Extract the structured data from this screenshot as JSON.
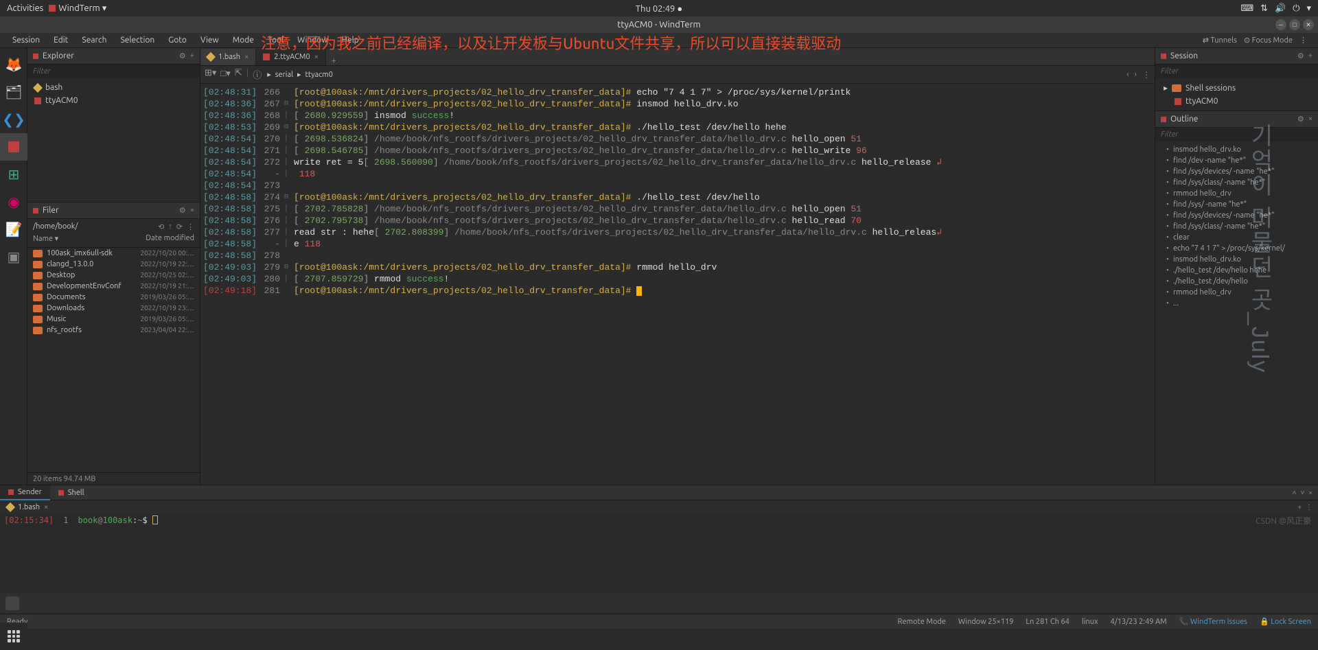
{
  "topbar": {
    "activities": "Activities",
    "app": "WindTerm ▾",
    "clock": "Thu 02:49 ●",
    "tray": [
      "⌨",
      "⇅",
      "🔊",
      "⏻",
      "▾"
    ]
  },
  "titlebar": {
    "title": "ttyACM0 - WindTerm"
  },
  "annotation": "注意，因为我之前已经编译，以及让开发板与Ubuntu文件共享，所以可以直接装载驱动",
  "watermark": "기억이 머물던 곳_July",
  "credit": "CSDN @风正豪",
  "menu": [
    "Session",
    "Edit",
    "Search",
    "Selection",
    "Goto",
    "View",
    "Mode",
    "Tool",
    "Window",
    "Help"
  ],
  "menu_right": {
    "tunnels": "⇄ Tunnels",
    "focus": "⊙ Focus Mode"
  },
  "explorer": {
    "title": "Explorer",
    "filter": "Filter",
    "items": [
      {
        "label": "bash",
        "icon": "diamond"
      },
      {
        "label": "ttyACM0",
        "icon": "sq"
      }
    ]
  },
  "filer": {
    "title": "Filer",
    "path": "/home/book/",
    "col_name": "Name",
    "col_date": "Date modified",
    "rows": [
      {
        "name": "100ask_imx6ull-sdk",
        "date": "2022/10/20 00:…"
      },
      {
        "name": "clangd_13.0.0",
        "date": "2022/10/19 22:…"
      },
      {
        "name": "Desktop",
        "date": "2022/10/25 02:…"
      },
      {
        "name": "DevelopmentEnvConf",
        "date": "2022/10/19 21:…"
      },
      {
        "name": "Documents",
        "date": "2019/03/26 05:…"
      },
      {
        "name": "Downloads",
        "date": "2022/10/19 23:…"
      },
      {
        "name": "Music",
        "date": "2019/03/26 05:…"
      },
      {
        "name": "nfs_rootfs",
        "date": "2023/04/04 22:…"
      }
    ],
    "status": "20 items 94.74 MB"
  },
  "tabs": [
    {
      "label": "1.bash",
      "icon": "diamond"
    },
    {
      "label": "2.ttyACM0",
      "icon": "sq"
    }
  ],
  "breadcrumb": {
    "a": "serial",
    "b": "ttyacm0"
  },
  "terminal": {
    "prompt": "[root@100ask:/mnt/drivers_projects/02_hello_drv_transfer_data]#",
    "lines": [
      {
        "ts": "[02:48:31]",
        "n": "266",
        "g": "",
        "body": [
          [
            "prompt",
            "[root@100ask:/mnt/drivers_projects/02_hello_drv_transfer_data]# "
          ],
          [
            "cmd-white",
            "echo \"7 4 1 7\" > /proc/sys/kernel/printk"
          ]
        ]
      },
      {
        "ts": "[02:48:36]",
        "n": "267",
        "g": "⊟",
        "body": [
          [
            "prompt",
            "[root@100ask:/mnt/drivers_projects/02_hello_drv_transfer_data]# "
          ],
          [
            "cmd-white",
            "insmod hello_drv.ko"
          ]
        ]
      },
      {
        "ts": "[02:48:36]",
        "n": "268",
        "g": "│",
        "body": [
          [
            "bracket",
            "[ "
          ],
          [
            "time-green",
            "2680.929559"
          ],
          [
            "bracket",
            "] "
          ],
          [
            "cmd-white",
            "insmod "
          ],
          [
            "success",
            "success"
          ],
          [
            "cmd-white",
            "!"
          ]
        ]
      },
      {
        "ts": "[02:48:53]",
        "n": "269",
        "g": "⊟",
        "body": [
          [
            "prompt",
            "[root@100ask:/mnt/drivers_projects/02_hello_drv_transfer_data]# "
          ],
          [
            "cmd-white",
            "./hello_test /dev/hello hehe"
          ]
        ]
      },
      {
        "ts": "[02:48:54]",
        "n": "270",
        "g": "│",
        "body": [
          [
            "bracket",
            "[ "
          ],
          [
            "time-green",
            "2698.536824"
          ],
          [
            "bracket",
            "] "
          ],
          [
            "path-cyan",
            "/home/book/nfs_rootfs/drivers_projects/02_hello_drv_transfer_data/hello_drv.c "
          ],
          [
            "cmd-white",
            "hello_open "
          ],
          [
            "num-red",
            "51"
          ]
        ]
      },
      {
        "ts": "[02:48:54]",
        "n": "271",
        "g": "│",
        "body": [
          [
            "bracket",
            "[ "
          ],
          [
            "time-green",
            "2698.546785"
          ],
          [
            "bracket",
            "] "
          ],
          [
            "path-cyan",
            "/home/book/nfs_rootfs/drivers_projects/02_hello_drv_transfer_data/hello_drv.c "
          ],
          [
            "cmd-white",
            "hello_write "
          ],
          [
            "num-red",
            "96"
          ]
        ]
      },
      {
        "ts": "[02:48:54]",
        "n": "272",
        "g": "│",
        "body": [
          [
            "cmd-white",
            "write ret = 5"
          ],
          [
            "bracket",
            "[ "
          ],
          [
            "time-green",
            "2698.560090"
          ],
          [
            "bracket",
            "] "
          ],
          [
            "path-cyan",
            "/home/book/nfs_rootfs/drivers_projects/02_hello_drv_transfer_data/hello_drv.c "
          ],
          [
            "cmd-white",
            "hello_release "
          ],
          [
            "num-red",
            "↲"
          ]
        ]
      },
      {
        "ts": "[02:48:54]",
        "n": "-",
        "g": "│",
        "body": [
          [
            "cmd-white",
            " "
          ],
          [
            "num-red",
            "118"
          ]
        ]
      },
      {
        "ts": "[02:48:54]",
        "n": "273",
        "g": "",
        "body": []
      },
      {
        "ts": "[02:48:58]",
        "n": "274",
        "g": "⊟",
        "body": [
          [
            "prompt",
            "[root@100ask:/mnt/drivers_projects/02_hello_drv_transfer_data]# "
          ],
          [
            "cmd-white",
            "./hello_test /dev/hello"
          ]
        ]
      },
      {
        "ts": "[02:48:58]",
        "n": "275",
        "g": "│",
        "body": [
          [
            "bracket",
            "[ "
          ],
          [
            "time-green",
            "2702.785828"
          ],
          [
            "bracket",
            "] "
          ],
          [
            "path-cyan",
            "/home/book/nfs_rootfs/drivers_projects/02_hello_drv_transfer_data/hello_drv.c "
          ],
          [
            "cmd-white",
            "hello_open "
          ],
          [
            "num-red",
            "51"
          ]
        ]
      },
      {
        "ts": "[02:48:58]",
        "n": "276",
        "g": "│",
        "body": [
          [
            "bracket",
            "[ "
          ],
          [
            "time-green",
            "2702.795738"
          ],
          [
            "bracket",
            "] "
          ],
          [
            "path-cyan",
            "/home/book/nfs_rootfs/drivers_projects/02_hello_drv_transfer_data/hello_drv.c "
          ],
          [
            "cmd-white",
            "hello_read "
          ],
          [
            "num-red",
            "70"
          ]
        ]
      },
      {
        "ts": "[02:48:58]",
        "n": "277",
        "g": "│",
        "body": [
          [
            "cmd-white",
            "read str : hehe"
          ],
          [
            "bracket",
            "[ "
          ],
          [
            "time-green",
            "2702.808399"
          ],
          [
            "bracket",
            "] "
          ],
          [
            "path-cyan",
            "/home/book/nfs_rootfs/drivers_projects/02_hello_drv_transfer_data/hello_drv.c "
          ],
          [
            "cmd-white",
            "hello_releas"
          ],
          [
            "num-red",
            "↲"
          ]
        ]
      },
      {
        "ts": "[02:48:58]",
        "n": "-",
        "g": "│",
        "body": [
          [
            "cmd-white",
            "e "
          ],
          [
            "num-red",
            "118"
          ]
        ]
      },
      {
        "ts": "[02:48:58]",
        "n": "278",
        "g": "",
        "body": []
      },
      {
        "ts": "[02:49:03]",
        "n": "279",
        "g": "⊟",
        "body": [
          [
            "prompt",
            "[root@100ask:/mnt/drivers_projects/02_hello_drv_transfer_data]# "
          ],
          [
            "cmd-white",
            "rmmod hello_drv"
          ]
        ]
      },
      {
        "ts": "[02:49:03]",
        "n": "280",
        "g": "│",
        "body": [
          [
            "bracket",
            "[ "
          ],
          [
            "time-green",
            "2707.859729"
          ],
          [
            "bracket",
            "] "
          ],
          [
            "cmd-white",
            "rmmod "
          ],
          [
            "success",
            "success"
          ],
          [
            "cmd-white",
            "!"
          ]
        ]
      },
      {
        "ts": "[02:49:18]",
        "n": "281",
        "g": "",
        "tsred": true,
        "body": [
          [
            "prompt",
            "[root@100ask:/mnt/drivers_projects/02_hello_drv_transfer_data]# "
          ],
          [
            "cursor",
            ""
          ]
        ]
      }
    ]
  },
  "session": {
    "title": "Session",
    "filter": "Filter",
    "group": "Shell sessions",
    "items": [
      "ttyACM0"
    ]
  },
  "outline": {
    "title": "Outline",
    "filter": "Filter",
    "items": [
      "insmod hello_drv.ko",
      "find /dev -name \"he*\"",
      "find /sys/devices/ -name \"he*\"",
      "find /sys/class/ -name \"he*\"",
      "rmmod hello_drv",
      "find /sys/ -name \"he*\"",
      "find /sys/devices/ -name \"he*\"",
      "find /sys/class/ -name \"he*\"",
      "clear",
      "echo \"7 4 1 7\" > /proc/sys/kernel/",
      "insmod hello_drv.ko",
      "./hello_test /dev/hello hehe",
      "./hello_test /dev/hello",
      "rmmod hello_drv",
      "..."
    ]
  },
  "bottom": {
    "tabs": [
      "Sender",
      "Shell"
    ],
    "subtab": "1.bash",
    "line": {
      "ts": "[02:15:34]",
      "n": "1",
      "user": "book",
      "host": "100ask",
      "path": "~"
    }
  },
  "status": {
    "ready": "Ready",
    "remote": "Remote Mode",
    "window": "Window 25×119",
    "pos": "Ln 281 Ch 64",
    "os": "linux",
    "datetime": "4/13/23 2:49 AM",
    "issues": "WindTerm Issues",
    "lock": "Lock Screen"
  }
}
